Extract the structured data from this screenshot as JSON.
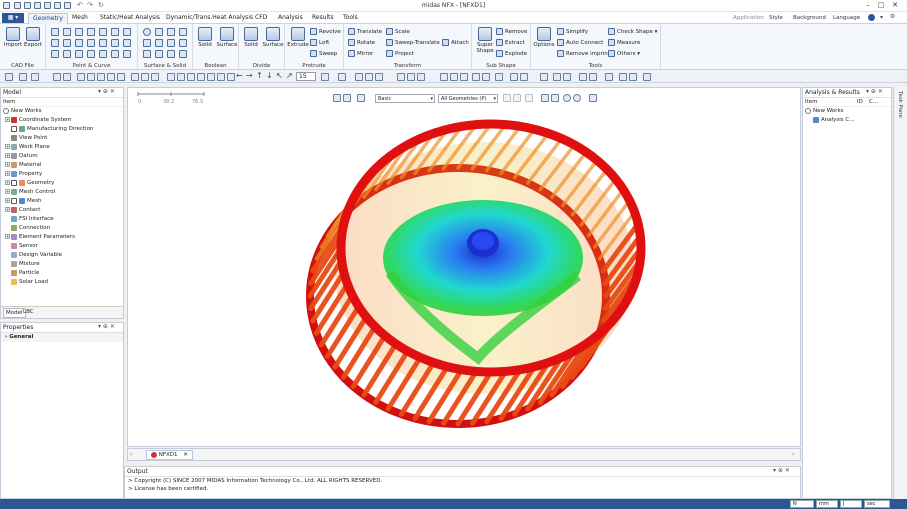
{
  "window": {
    "title": "midas NFX - [NFXD1]"
  },
  "app_button": {
    "label": "▦ ▾"
  },
  "menu": {
    "tabs": [
      "Geometry",
      "Mesh",
      "Static/Heat Analysis",
      "Dynamic/Trans.Heat Analysis",
      "CFD",
      "Analysis",
      "Results",
      "Tools"
    ],
    "right": {
      "application": "Application",
      "style": "Style",
      "background": "Background",
      "language": "Language"
    }
  },
  "ribbon": {
    "cad_file": {
      "label": "CAD File",
      "import": "Import",
      "export": "Export"
    },
    "point_curve": {
      "label": "Point & Curve"
    },
    "surface_solid": {
      "label": "Surface & Solid"
    },
    "boolean": {
      "label": "Boolean",
      "solid": "Solid",
      "surface": "Surface"
    },
    "divide": {
      "label": "Divide",
      "solid": "Solid",
      "surface": "Surface"
    },
    "protrude": {
      "label": "Protrude",
      "extrude": "Extrude",
      "revolve": "Revolve",
      "loft": "Loft",
      "sweep": "Sweep"
    },
    "transform": {
      "label": "Transform",
      "translate": "Translate",
      "rotate": "Rotate",
      "mirror": "Mirror",
      "scale": "Scale",
      "sweep_translate": "Sweep-Translate",
      "project": "Project",
      "attach": "Attach"
    },
    "sub_shape": {
      "label": "Sub Shape",
      "super_shape": "Super Shape",
      "remove": "Remove",
      "extract": "Extract",
      "explode": "Explode"
    },
    "tools": {
      "label": "Tools",
      "options": "Options",
      "simplify": "Simplify",
      "auto_connect": "Auto Connect",
      "remove_imprint": "Remove imprint",
      "check_shape": "Check Shape",
      "measure": "Measure",
      "others": "Others"
    }
  },
  "toolbar": {
    "number_field": "15"
  },
  "model_panel": {
    "title": "Model",
    "column": "Item",
    "root": "New Works",
    "items": [
      "Coordinate System",
      "Manufacturing Direction",
      "View Point",
      "Work Plane",
      "Datum",
      "Material",
      "Property",
      "Geometry",
      "Mesh Control",
      "Mesh",
      "Contact",
      "FSI Interface",
      "Connection",
      "Element Parameters",
      "Sensor",
      "Design Variable",
      "Mixture",
      "Particle",
      "Solar Load"
    ],
    "tabs": [
      "Model",
      "LBC"
    ]
  },
  "properties_panel": {
    "title": "Properties",
    "section": "General"
  },
  "viewport": {
    "scale": {
      "labels": [
        "0",
        "38.2",
        "76.5"
      ]
    },
    "display_mode": "Basic",
    "geometry_filter": "All Geometries (P)",
    "doc_tab": "NFXD1"
  },
  "analysis_panel": {
    "title": "Analysis & Results",
    "columns": {
      "item": "Item",
      "id": "ID",
      "c": "C..."
    },
    "root": "New Works",
    "child": "Analysis C..."
  },
  "task_pane": {
    "label": "Task Pane"
  },
  "output": {
    "title": "Output",
    "lines": [
      "> Copyright (C) SINCE 2007 MIDAS Information Technology Co., Ltd. ALL RIGHTS RESERVED.",
      "> License has been certified."
    ]
  },
  "status": {
    "n": "N",
    "unit": "mm",
    "j": "J",
    "time": "sec"
  },
  "colors": {
    "accent": "#2b5797",
    "fan_red": "#e01010",
    "fan_green": "#35d040",
    "fan_blue": "#1a2fd0"
  }
}
